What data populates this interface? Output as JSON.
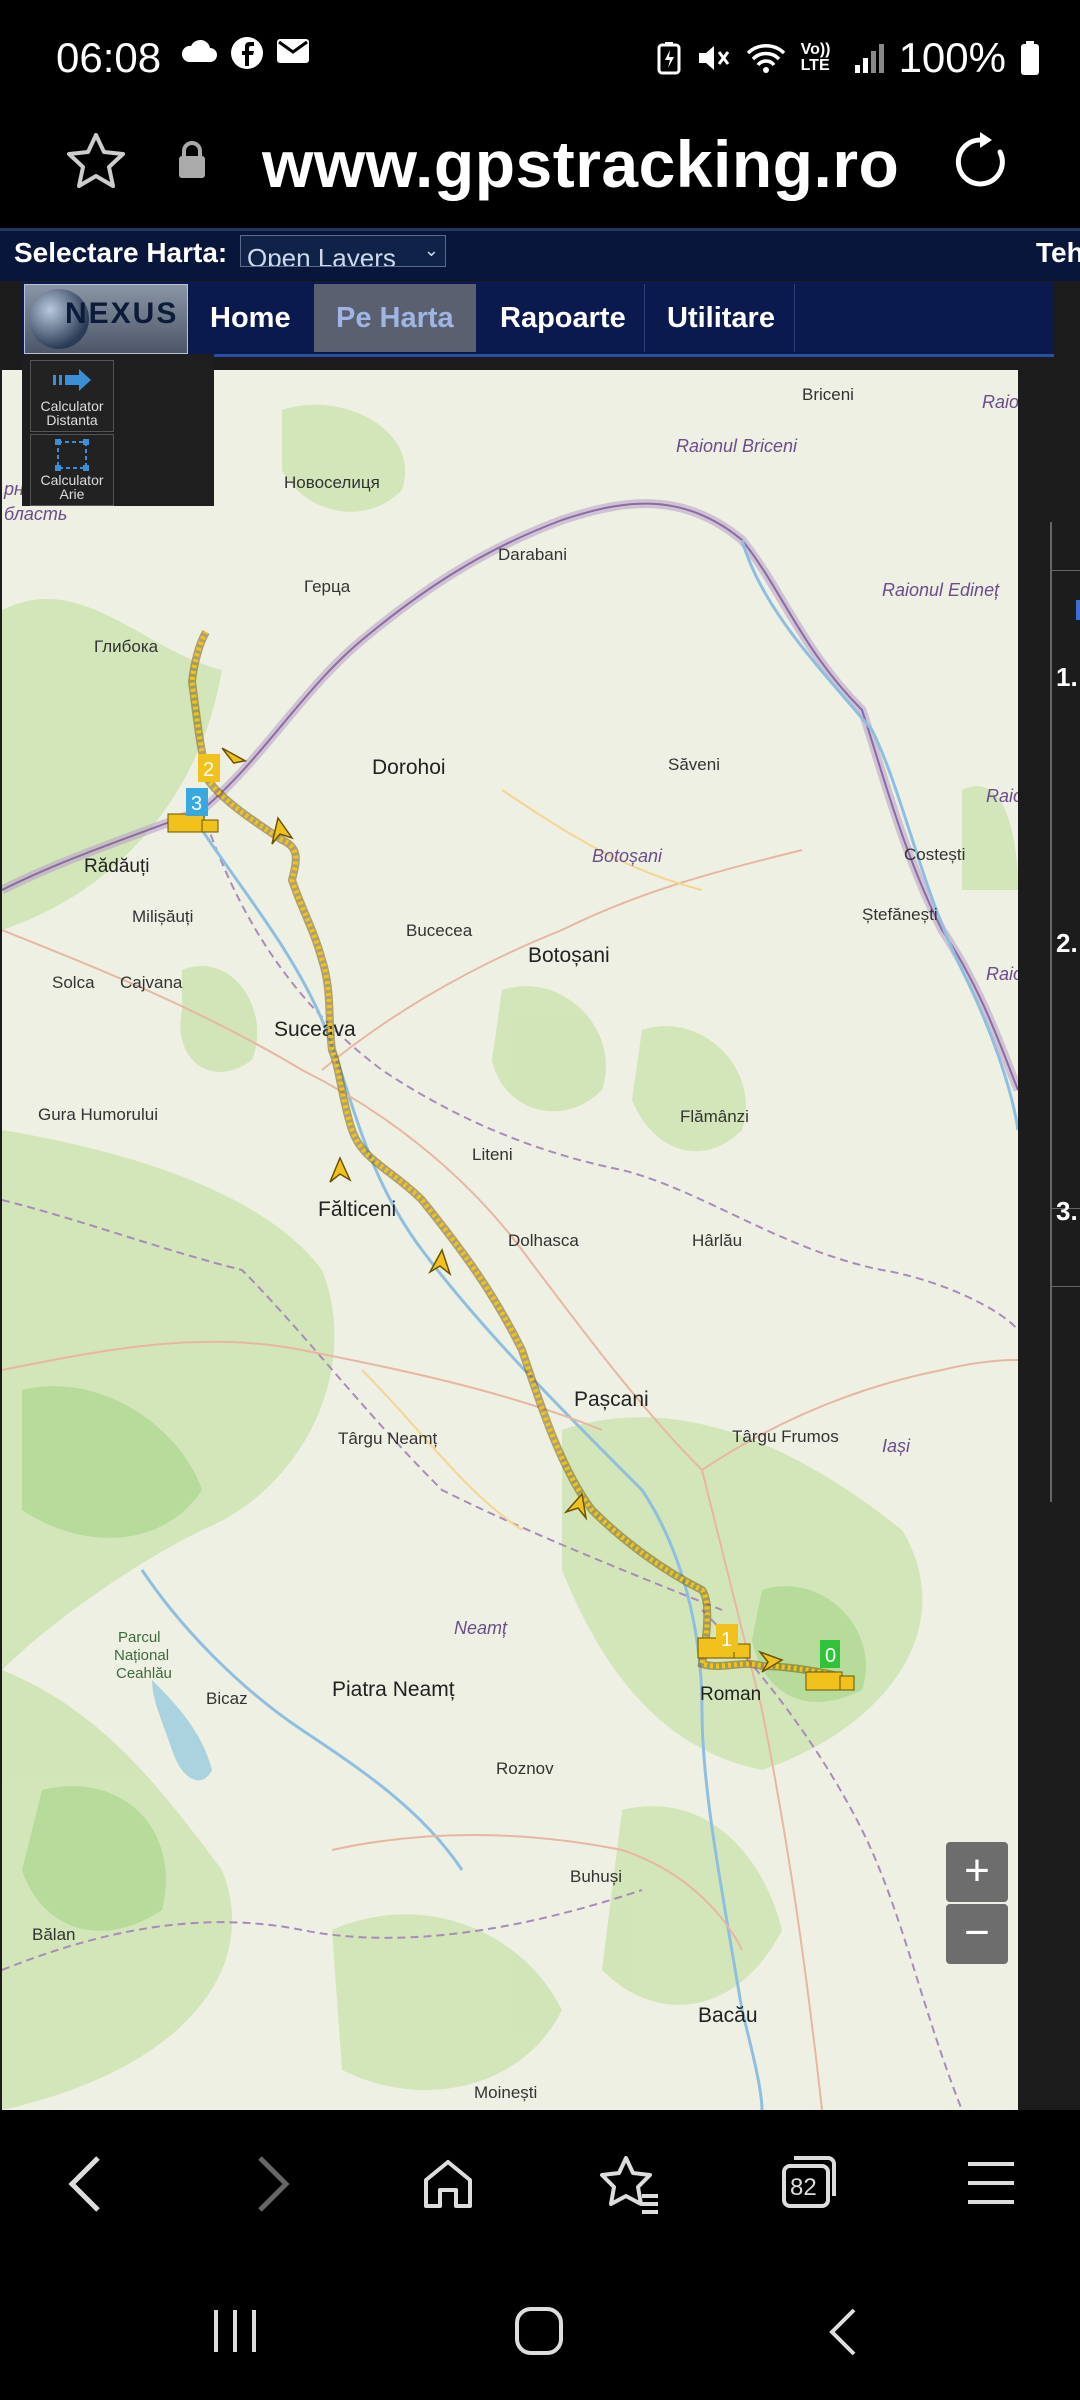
{
  "status_bar": {
    "time": "06:08",
    "battery": "100%",
    "icons_left": [
      "cloud-icon",
      "facebook-icon",
      "mail-icon"
    ],
    "icons_right": [
      "battery-saver-icon",
      "mute-icon",
      "wifi-icon",
      "volte-icon",
      "signal-icon",
      "battery-icon"
    ],
    "volte_label": "Vo)) LTE"
  },
  "browser": {
    "url": "www.gpstracking.ro",
    "tab_count": "82"
  },
  "page": {
    "map_select_label": "Selectare Harta:",
    "map_select_value": "Open Layers",
    "right_truncated": "Teh",
    "logo_text": "NEXUS",
    "nav": [
      "Home",
      "Pe Harta",
      "Rapoarte",
      "Utilitare"
    ],
    "active_tab": "Pe Harta",
    "tools": [
      "Calculator Distanta",
      "Calculator Arie"
    ],
    "right_list_numbers": [
      "1.",
      "2.",
      "3."
    ],
    "zoom_in": "+",
    "zoom_out": "−"
  },
  "map": {
    "markers": [
      "0",
      "1",
      "2",
      "3"
    ],
    "labels": {
      "briceni": "Briceni",
      "raion1": "Raio",
      "raionul_briceni": "Raionul Briceni",
      "novoselytsia": "Новоселиця",
      "darabani": "Darabani",
      "chern": "рнівецька",
      "oblast": "бласть",
      "hertsa": "Герца",
      "raionul_edinet": "Raionul Edineț",
      "hlyboka": "Глибока",
      "dorohoi": "Dorohoi",
      "saveni": "Săveni",
      "radauti": "Rădăuți",
      "raion2": "Raio",
      "botosani_region": "Botoșani",
      "costesti": "Costești",
      "milisauti": "Milișăuți",
      "bucecea": "Bucecea",
      "stefanesti": "Ștefănești",
      "botosani": "Botoșani",
      "solca": "Solca",
      "cajvana": "Cajvana",
      "raion3": "Raio",
      "suceava": "Suceava",
      "gura": "Gura Humorului",
      "flamanzi": "Flămânzi",
      "liteni": "Liteni",
      "falticeni": "Fălticeni",
      "dolhasca": "Dolhasca",
      "harlau": "Hârlău",
      "pascani": "Pașcani",
      "targu_neamt": "Târgu Neamț",
      "targu_frumos": "Târgu Frumos",
      "iasi": "Iași",
      "neamt": "Neamț",
      "parc1": "Parcul",
      "parc2": "Național",
      "parc3": "Ceahlău",
      "bicaz": "Bicaz",
      "piatra": "Piatra Neamț",
      "roman": "Roman",
      "roznov": "Roznov",
      "buhusi": "Buhuși",
      "balan": "Bălan",
      "bacau": "Bacău",
      "moinesti": "Moinești"
    }
  },
  "colors": {
    "track": "#f2c21c",
    "nav_bg": "#0a1a4e",
    "active_tab": "#5b6070",
    "map_bg": "#eef0e4"
  }
}
